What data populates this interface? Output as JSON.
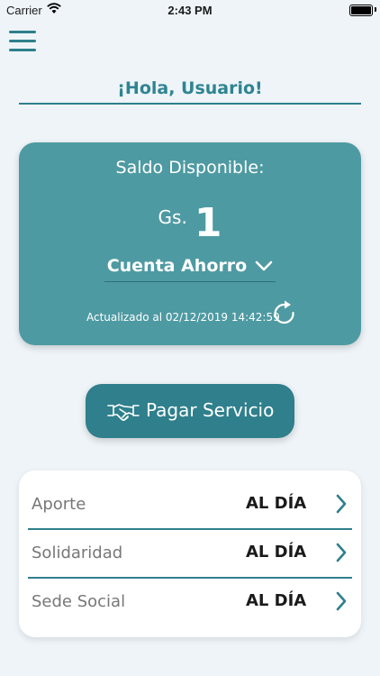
{
  "status_bar": {
    "carrier": "Carrier",
    "time": "2:43 PM"
  },
  "greeting": "¡Hola, Usuario!",
  "balance": {
    "label": "Saldo Disponible:",
    "currency": "Gs.",
    "amount": "1",
    "account": "Cuenta Ahorro",
    "updated": "Actualizado al 02/12/2019 14:42:59"
  },
  "pay_button": {
    "label": "Pagar Servicio"
  },
  "status_rows": [
    {
      "label": "Aporte",
      "value": "AL DÍA"
    },
    {
      "label": "Solidaridad",
      "value": "AL DÍA"
    },
    {
      "label": "Sede Social",
      "value": "AL DÍA"
    }
  ],
  "colors": {
    "accent": "#2f7f8c",
    "card": "#4e9aa2",
    "background": "#eef4f8"
  },
  "icons": [
    "menu-icon",
    "chevron-down-icon",
    "refresh-icon",
    "handshake-icon",
    "chevron-right-icon"
  ]
}
